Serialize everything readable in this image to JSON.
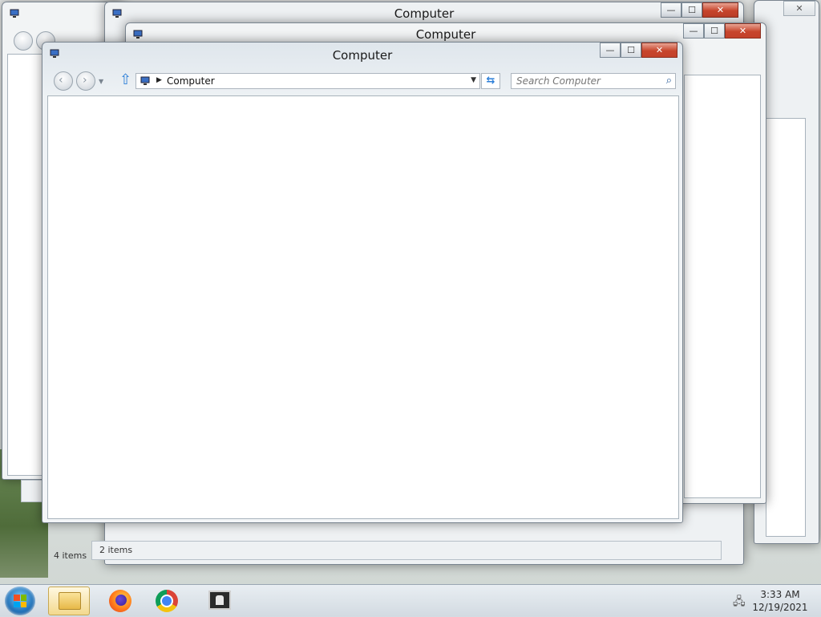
{
  "windows": [
    {
      "id": "back-1",
      "title": "",
      "status": "2"
    },
    {
      "id": "back-2",
      "title": "Computer",
      "status": "4 items"
    },
    {
      "id": "back-3",
      "title": "Computer",
      "status": "2 items"
    },
    {
      "id": "front",
      "title": "Computer",
      "address": {
        "path_label": "Computer"
      },
      "search": {
        "placeholder": "Search Computer"
      }
    }
  ],
  "caption_buttons": {
    "minimize": "—",
    "maximize": "☐",
    "close": "✕"
  },
  "icons": {
    "back": "back-arrow-icon",
    "forward": "forward-arrow-icon",
    "up": "up-arrow-icon",
    "refresh": "refresh-icon",
    "search": "search-icon",
    "computer": "computer-icon"
  },
  "taskbar": {
    "items": [
      {
        "name": "windows-explorer",
        "active": true
      },
      {
        "name": "firefox",
        "active": false
      },
      {
        "name": "chrome",
        "active": false
      },
      {
        "name": "terminal-app",
        "active": false
      }
    ],
    "clock": {
      "time": "3:33 AM",
      "date": "12/19/2021"
    }
  },
  "colors": {
    "accent": "#2d7fd8",
    "close_red": "#c7452c"
  }
}
